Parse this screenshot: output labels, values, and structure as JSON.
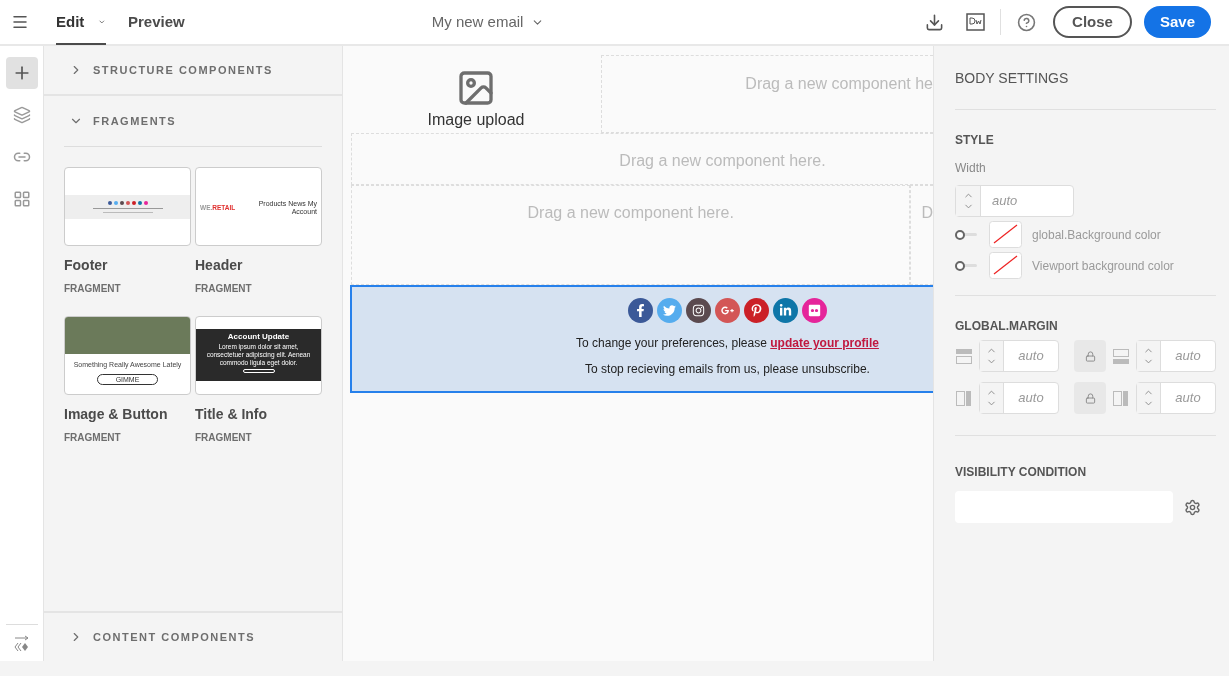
{
  "topbar": {
    "tabs": [
      {
        "label": "Edit",
        "selected": true,
        "has_menu": true
      },
      {
        "label": "Preview",
        "selected": false,
        "has_menu": false
      }
    ],
    "document_title": "My new email",
    "close_button": "Close",
    "save_button": "Save"
  },
  "rail": [
    {
      "kind": "add",
      "selected": true
    },
    {
      "kind": "layers",
      "selected": false
    },
    {
      "kind": "link",
      "selected": false
    },
    {
      "kind": "grid",
      "selected": false
    }
  ],
  "left_panel": {
    "sections": [
      {
        "title": "STRUCTURE COMPONENTS",
        "expanded": false
      },
      {
        "title": "FRAGMENTS",
        "expanded": true
      }
    ],
    "fragments": [
      {
        "kind": "footer",
        "name": "Footer",
        "type": "FRAGMENT"
      },
      {
        "kind": "header",
        "name": "Header",
        "type": "FRAGMENT",
        "logo_a": "WE.",
        "logo_b": "RETAIL",
        "nav": "Products  News  My Account"
      },
      {
        "kind": "image_button",
        "name": "Image & Button",
        "type": "FRAGMENT",
        "caption": "Something Really Awesome Lately",
        "button": "GIMME"
      },
      {
        "kind": "title_info",
        "name": "Title & Info",
        "type": "FRAGMENT",
        "heading": "Account Update",
        "body": "Lorem ipsum dolor sit amet, consectetuer adipiscing elit. Aenean commodo ligula eget dolor."
      }
    ],
    "bottom_section": {
      "title": "CONTENT COMPONENTS",
      "expanded": false
    }
  },
  "canvas": {
    "image_upload": "Image upload",
    "drop_zones": [
      "Drag a new component he",
      "Drag a new component here.",
      "Drag a new component here.",
      "D"
    ],
    "footer": {
      "selected": true,
      "social": [
        {
          "kind": "facebook",
          "color": "#3b5998"
        },
        {
          "kind": "twitter",
          "color": "#55acee"
        },
        {
          "kind": "instagram",
          "color": "#5b4a4f"
        },
        {
          "kind": "googleplus",
          "color": "#d35656"
        },
        {
          "kind": "pinterest",
          "color": "#cb2027"
        },
        {
          "kind": "linkedin",
          "color": "#0e76a8"
        },
        {
          "kind": "flickr",
          "color": "#e5259a"
        }
      ],
      "preferences_text": "To change your preferences, please",
      "link": "update your profile",
      "unsubscribe_text": "To stop recieving emails from us, please unsubscribe."
    }
  },
  "right_panel": {
    "title": "BODY SETTINGS",
    "style": {
      "heading": "STYLE",
      "width_label": "Width",
      "width_placeholder": "auto",
      "colors": [
        {
          "label": "global.Background color",
          "on": false
        },
        {
          "label": "Viewport background color",
          "on": false
        }
      ]
    },
    "margin": {
      "heading": "GLOBAL.MARGIN",
      "fields": [
        {
          "kind": "top",
          "placeholder": "auto"
        },
        {
          "kind": "bottom",
          "placeholder": "auto"
        },
        {
          "kind": "left",
          "placeholder": "auto"
        },
        {
          "kind": "right",
          "placeholder": "auto"
        }
      ],
      "locks": [
        {
          "locked": true
        },
        {
          "locked": true
        }
      ]
    },
    "visibility": {
      "heading": "VISIBILITY CONDITION"
    }
  }
}
